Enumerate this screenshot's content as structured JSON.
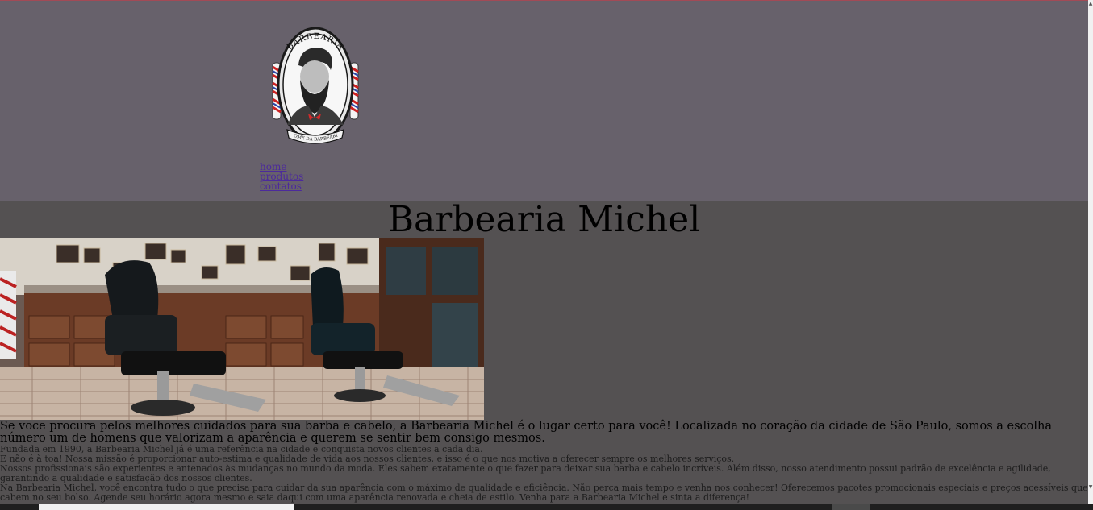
{
  "header": {
    "logo": {
      "top_text": "BARBEARIA",
      "bottom_text": "NOME DA BARBEARIA",
      "icon": "barber-logo-emblem"
    },
    "nav": [
      {
        "label": "home"
      },
      {
        "label": "produtos"
      },
      {
        "label": "contatos"
      }
    ]
  },
  "main": {
    "title": "Barbearia Michel",
    "hero_image": "barbershop-interior-photo",
    "lead": "Se voce procura pelos melhores cuidados para sua barba e cabelo, a Barbearia Michel é o lugar certo para você! Localizada no coração da cidade de São Paulo, somos a escolha número um de homens que valorizam a aparência e querem se sentir bem consigo mesmos.",
    "paragraphs": [
      "Fundada em 1990, a Barbearia Michel já é uma referência na cidade e conquista novos clientes a cada dia.",
      "E não é à toa! Nossa missão é proporcionar auto-estima e qualidade de vida aos nossos clientes, e isso é o que nos motiva a oferecer sempre os melhores serviços.",
      "Nossos profissionais são experientes e antenados às mudanças no mundo da moda. Eles sabem exatamente o que fazer para deixar sua barba e cabelo incríveis. Além disso, nosso atendimento possui padrão de excelência e agilidade, garantindo a qualidade e satisfação dos nossos clientes.",
      "Na Barbearia Michel, você encontra tudo o que precisa para cuidar da sua aparência com o máximo de qualidade e eficiência. Não perca mais tempo e venha nos conhecer! Oferecemos pacotes promocionais especiais e preços acessíveis que cabem no seu bolso. Agende seu horário agora mesmo e saia daqui com uma aparência renovada e cheia de estilo. Venha para a Barbearia Michel e sinta a diferença!"
    ]
  },
  "colors": {
    "header_bg": "#67616b",
    "page_bg": "#545152",
    "link": "#4c2a9c"
  }
}
